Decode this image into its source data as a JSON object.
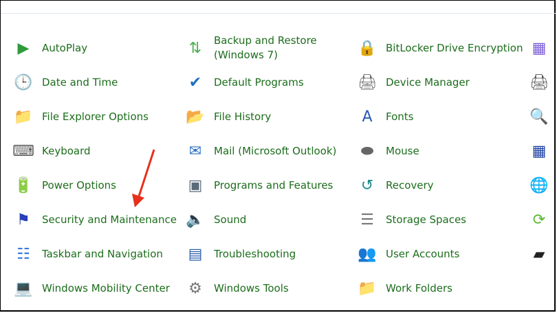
{
  "items": [
    {
      "label": "AutoPlay",
      "icon": "autoplay-icon",
      "glyph": "▶",
      "color": "#2e9b3a"
    },
    {
      "label": "Backup and Restore\n(Windows 7)",
      "icon": "backup-restore-icon",
      "glyph": "⇅",
      "color": "#4caf50"
    },
    {
      "label": "BitLocker Drive Encryption",
      "icon": "bitlocker-icon",
      "glyph": "🔒",
      "color": "#b08a3a"
    },
    {
      "label": "",
      "icon": "color-management-icon",
      "glyph": "▦",
      "color": "#7b5cd6"
    },
    {
      "label": "Date and Time",
      "icon": "date-time-icon",
      "glyph": "🕒",
      "color": "#3a7bd5"
    },
    {
      "label": "Default Programs",
      "icon": "default-programs-icon",
      "glyph": "✔",
      "color": "#1e6fbf"
    },
    {
      "label": "Device Manager",
      "icon": "device-manager-icon",
      "glyph": "🖨",
      "color": "#666"
    },
    {
      "label": "",
      "icon": "devices-printers-icon",
      "glyph": "🖨",
      "color": "#555"
    },
    {
      "label": "File Explorer Options",
      "icon": "folder-options-icon",
      "glyph": "📁",
      "color": "#e8b64a"
    },
    {
      "label": "File History",
      "icon": "file-history-icon",
      "glyph": "📂",
      "color": "#e8b64a"
    },
    {
      "label": "Fonts",
      "icon": "fonts-icon",
      "glyph": "A",
      "color": "#2a58b8"
    },
    {
      "label": "",
      "icon": "indexing-options-icon",
      "glyph": "🔍",
      "color": "#6a8fb0"
    },
    {
      "label": "Keyboard",
      "icon": "keyboard-icon",
      "glyph": "⌨",
      "color": "#555"
    },
    {
      "label": "Mail (Microsoft Outlook)",
      "icon": "mail-icon",
      "glyph": "✉",
      "color": "#2a6fc2"
    },
    {
      "label": "Mouse",
      "icon": "mouse-icon",
      "glyph": "⬬",
      "color": "#666"
    },
    {
      "label": "",
      "icon": "network-sharing-icon",
      "glyph": "▦",
      "color": "#1a3fa0"
    },
    {
      "label": "Power Options",
      "icon": "power-options-icon",
      "glyph": "🔋",
      "color": "#3a8a3a"
    },
    {
      "label": "Programs and Features",
      "icon": "programs-features-icon",
      "glyph": "▣",
      "color": "#5a6a7a"
    },
    {
      "label": "Recovery",
      "icon": "recovery-icon",
      "glyph": "↺",
      "color": "#1d8a8a"
    },
    {
      "label": "",
      "icon": "region-icon",
      "glyph": "🌐",
      "color": "#2a7ad0"
    },
    {
      "label": "Security and Maintenance",
      "icon": "security-flag-icon",
      "glyph": "⚑",
      "color": "#2a3fb8"
    },
    {
      "label": "Sound",
      "icon": "sound-icon",
      "glyph": "🔈",
      "color": "#777"
    },
    {
      "label": "Storage Spaces",
      "icon": "storage-spaces-icon",
      "glyph": "☰",
      "color": "#777"
    },
    {
      "label": "",
      "icon": "sync-center-icon",
      "glyph": "⟳",
      "color": "#5cb82e"
    },
    {
      "label": "Taskbar and Navigation",
      "icon": "taskbar-icon",
      "glyph": "☷",
      "color": "#3a7bd5"
    },
    {
      "label": "Troubleshooting",
      "icon": "troubleshooting-icon",
      "glyph": "▤",
      "color": "#2a5fa8"
    },
    {
      "label": "User Accounts",
      "icon": "user-accounts-icon",
      "glyph": "👥",
      "color": "#5a8a3a"
    },
    {
      "label": "",
      "icon": "pen-tablet-icon",
      "glyph": "▰",
      "color": "#222"
    },
    {
      "label": "Windows Mobility Center",
      "icon": "mobility-center-icon",
      "glyph": "💻",
      "color": "#2a6fc2"
    },
    {
      "label": "Windows Tools",
      "icon": "windows-tools-icon",
      "glyph": "⚙",
      "color": "#777"
    },
    {
      "label": "Work Folders",
      "icon": "work-folders-icon",
      "glyph": "📁",
      "color": "#2a6fc2"
    }
  ],
  "annotation_color": "#e8301c"
}
